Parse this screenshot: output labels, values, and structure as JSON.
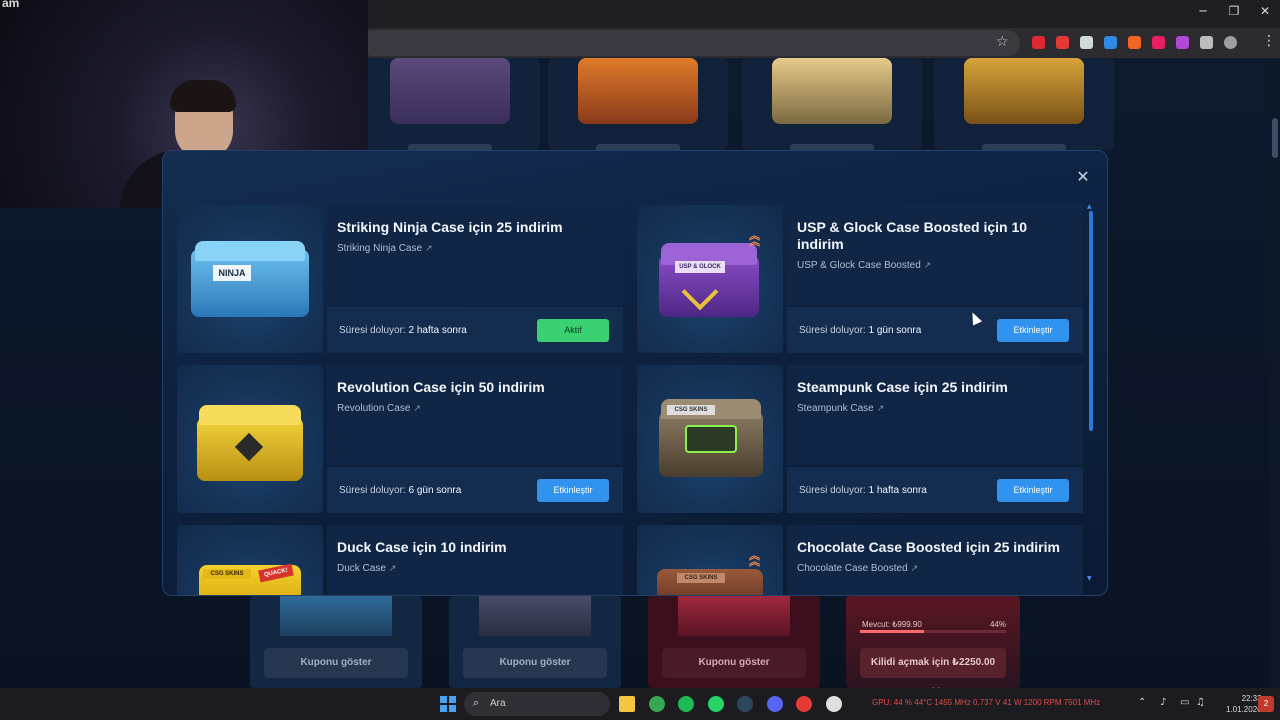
{
  "webcam": {
    "corner_text": "am"
  },
  "browser": {
    "controls": {
      "minimize": "─",
      "restore": "❐",
      "close": "✕"
    },
    "star_icon": "☆",
    "menu_icon": "⋮",
    "extensions": [
      {
        "name": "ext-red-icon",
        "color": "#e0282f"
      },
      {
        "name": "ext-youtube-icon",
        "color": "#e53935"
      },
      {
        "name": "ext-cloud-icon",
        "color": "#cfd8dc"
      },
      {
        "name": "ext-blue-icon",
        "color": "#2f8ae5"
      },
      {
        "name": "ext-orange-icon",
        "color": "#f26522"
      },
      {
        "name": "ext-tp-icon",
        "color": "#e91e63"
      },
      {
        "name": "ext-purple-icon",
        "color": "#b348d6"
      },
      {
        "name": "ext-puzzle-icon",
        "color": "#bdbdbd"
      },
      {
        "name": "profile-avatar-icon",
        "color": "#9e9e9e"
      }
    ]
  },
  "modal": {
    "close_icon": "✕",
    "cards": [
      {
        "title": "Striking Ninja Case için 25 indirim",
        "case_name": "Striking Ninja Case",
        "expiry_label": "Süresi doluyor:",
        "expiry_value": "2 hafta sonra",
        "button": "Aktif",
        "status": "active"
      },
      {
        "title": "USP & Glock Case Boosted için 10 indirim",
        "case_name": "USP & Glock Case Boosted",
        "expiry_label": "Süresi doluyor:",
        "expiry_value": "1 gün sonra",
        "button": "Etkinleştir",
        "boosted": true
      },
      {
        "title": "Revolution Case için 50 indirim",
        "case_name": "Revolution Case",
        "expiry_label": "Süresi doluyor:",
        "expiry_value": "6 gün sonra",
        "button": "Etkinleştir"
      },
      {
        "title": "Steampunk Case için 25 indirim",
        "case_name": "Steampunk Case",
        "expiry_label": "Süresi doluyor:",
        "expiry_value": "1 hafta sonra",
        "button": "Etkinleştir"
      },
      {
        "title": "Duck Case için 10 indirim",
        "case_name": "Duck Case"
      },
      {
        "title": "Chocolate Case Boosted için 25 indirim",
        "case_name": "Chocolate Case Boosted",
        "boosted": true
      }
    ],
    "case_badges": {
      "ninja": "NINJA",
      "usp": "USP & GLOCK",
      "generic": "CSG SKINS",
      "duck": "QUACK!"
    }
  },
  "background": {
    "coupon_buttons": [
      "Kuponu göster",
      "Kuponu göster",
      "Kuponu göster"
    ],
    "locked": {
      "available_label": "Mevcut: ₺999.90",
      "percent": "44%",
      "progress": 0.44,
      "unlock_button": "Kilidi açmak için ₺2250.00 yükle"
    }
  },
  "taskbar": {
    "start_icon": "windows-icon",
    "search_placeholder": "Ara",
    "apps": [
      {
        "name": "file-explorer-icon",
        "color": "#f4c542"
      },
      {
        "name": "chrome-icon",
        "color": "#34a853"
      },
      {
        "name": "spotify-icon",
        "color": "#1db954"
      },
      {
        "name": "whatsapp-icon",
        "color": "#25d366"
      },
      {
        "name": "steam-icon",
        "color": "#2a475e"
      },
      {
        "name": "discord-icon",
        "color": "#5865f2"
      },
      {
        "name": "app-red-icon",
        "color": "#e53935"
      },
      {
        "name": "app-rocket-icon",
        "color": "#e0e0e0"
      }
    ],
    "stats_text": "GPU: 44 % 44°C 1455 MHz 0.737 V 41 W 1200 RPM 7501 MHz",
    "time": "22:33",
    "date": "1.01.2026",
    "notification_count": "2"
  }
}
